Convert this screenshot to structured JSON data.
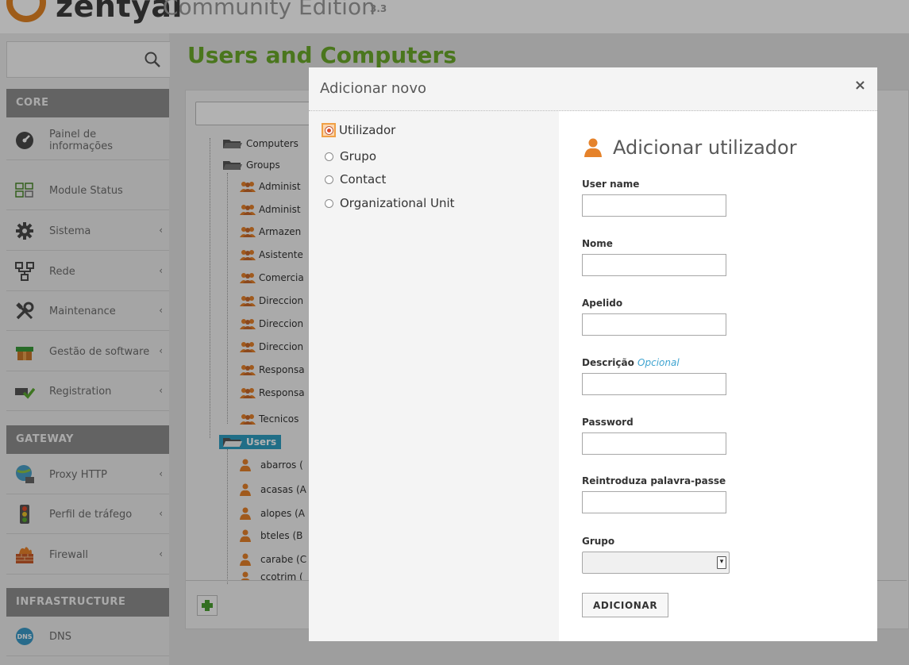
{
  "header": {
    "logo_text": "zentyal",
    "edition": "Community Edition",
    "version": "3.3"
  },
  "sidebar": {
    "sections": [
      {
        "title": "CORE"
      },
      {
        "title": "GATEWAY"
      },
      {
        "title": "INFRASTRUCTURE"
      }
    ],
    "items": [
      {
        "label": "Painel de informações",
        "icon": "dashboard-icon"
      },
      {
        "label": "Module Status",
        "icon": "module-status-icon"
      },
      {
        "label": "Sistema",
        "icon": "gear-icon",
        "has_arrow": true
      },
      {
        "label": "Rede",
        "icon": "network-icon",
        "has_arrow": true
      },
      {
        "label": "Maintenance",
        "icon": "tools-icon",
        "has_arrow": true
      },
      {
        "label": "Gestão de software",
        "icon": "software-box-icon",
        "has_arrow": true
      },
      {
        "label": "Registration",
        "icon": "registration-icon",
        "has_arrow": true
      },
      {
        "label": "Proxy HTTP",
        "icon": "proxy-icon",
        "has_arrow": true
      },
      {
        "label": "Perfil de tráfego",
        "icon": "traffic-light-icon",
        "has_arrow": true
      },
      {
        "label": "Firewall",
        "icon": "firewall-icon",
        "has_arrow": true
      },
      {
        "label": "DNS",
        "icon": "dns-icon"
      }
    ],
    "arrow": "‹"
  },
  "main": {
    "title": "Users and Computers",
    "tree": {
      "computers": "Computers",
      "groups": "Groups",
      "group_items": [
        "Administ",
        "Administ",
        "Armazen",
        "Asistente",
        "Comercia",
        "Direccion",
        "Direccion",
        "Direccion",
        "Responsa",
        "Responsa",
        "Tecnicos"
      ],
      "users": "Users",
      "user_items": [
        "abarros (",
        "acasas (A",
        "alopes (A",
        "bteles (B",
        "carabe (C",
        "ccotrim ("
      ]
    }
  },
  "modal": {
    "title": "Adicionar novo",
    "close": "×",
    "options": [
      {
        "label": "Utilizador",
        "checked": true
      },
      {
        "label": "Grupo",
        "checked": false
      },
      {
        "label": "Contact",
        "checked": false
      },
      {
        "label": "Organizational Unit",
        "checked": false
      }
    ],
    "form": {
      "heading": "Adicionar utilizador",
      "fields": [
        {
          "label": "User name"
        },
        {
          "label": "Nome"
        },
        {
          "label": "Apelido"
        },
        {
          "label": "Descrição",
          "optional": "Opcional"
        },
        {
          "label": "Password"
        },
        {
          "label": "Reintroduza palavra-passe"
        }
      ],
      "group_label": "Grupo",
      "group_value": "",
      "submit": "ADICIONAR"
    }
  },
  "colors": {
    "title_green": "#6aa92a",
    "accent_orange": "#e38425",
    "selection_blue": "#2e9ec2",
    "optional_blue": "#3fa4d0"
  }
}
